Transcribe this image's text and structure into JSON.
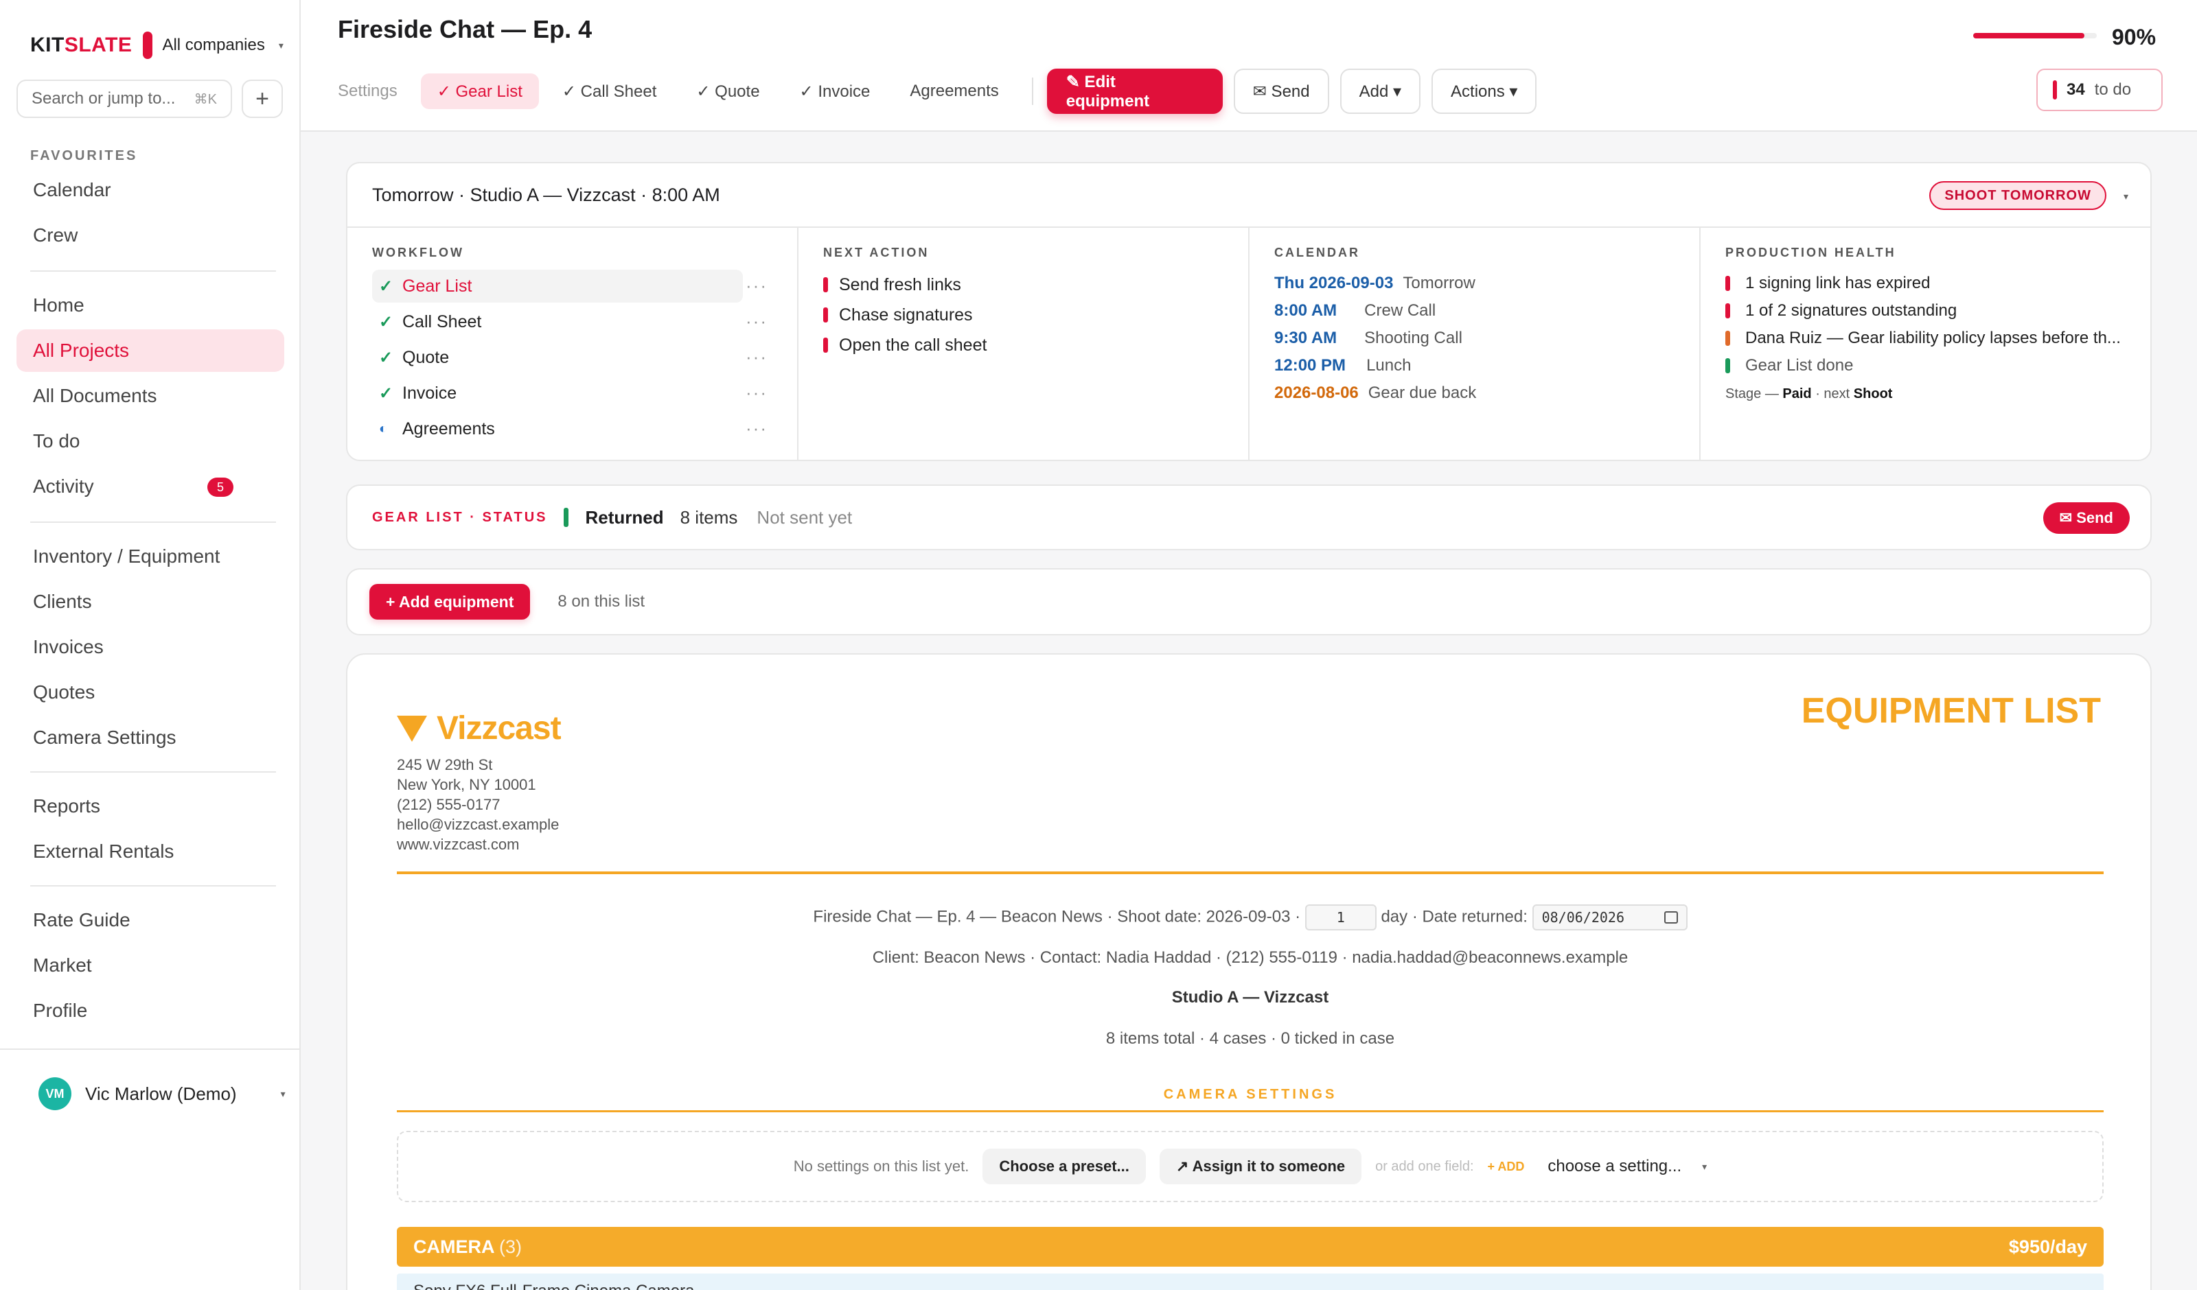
{
  "sidebar": {
    "brand_prefix": "KIT",
    "brand_suffix": "SLATE",
    "company": "All companies",
    "search_placeholder": "Search or jump to...",
    "search_shortcut": "⌘K",
    "add_label": "+",
    "favourites_label": "FAVOURITES",
    "favourites": [
      {
        "label": "Calendar"
      },
      {
        "label": "Crew"
      }
    ],
    "main": [
      {
        "label": "Home"
      },
      {
        "label": "All Projects"
      },
      {
        "label": "All Documents"
      },
      {
        "label": "To do"
      },
      {
        "label": "Activity",
        "badge": "5"
      }
    ],
    "resources": [
      {
        "label": "Inventory / Equipment"
      },
      {
        "label": "Clients"
      },
      {
        "label": "Invoices"
      },
      {
        "label": "Quotes"
      },
      {
        "label": "Camera Settings"
      }
    ],
    "reports": [
      {
        "label": "Reports"
      },
      {
        "label": "External Rentals"
      }
    ],
    "extra": [
      {
        "label": "Rate Guide"
      },
      {
        "label": "Market"
      },
      {
        "label": "Profile"
      }
    ],
    "user": {
      "initials": "VM",
      "name": "Vic Marlow (Demo)"
    }
  },
  "header": {
    "title": "Fireside Chat — Ep. 4",
    "progress_fraction": 0.9,
    "progress_pct": "90%",
    "tabs": [
      {
        "label": "Settings"
      },
      {
        "label": "✓ Gear List"
      },
      {
        "label": "✓ Call Sheet"
      },
      {
        "label": "✓ Quote"
      },
      {
        "label": "✓ Invoice"
      },
      {
        "label": "Agreements"
      }
    ],
    "edit_button": "✎ Edit equipment",
    "send_button": "✉ Send",
    "add_button": "Add ▾",
    "actions_button": "Actions ▾",
    "todo_count": "34",
    "todo_label": "to do"
  },
  "info": {
    "headline": "Tomorrow · Studio A — Vizzcast · 8:00 AM",
    "badge": "SHOOT TOMORROW",
    "workflow_label": "WORKFLOW",
    "workflow": [
      {
        "label": "Gear List",
        "state": "done"
      },
      {
        "label": "Call Sheet",
        "state": "done"
      },
      {
        "label": "Quote",
        "state": "done"
      },
      {
        "label": "Invoice",
        "state": "done"
      },
      {
        "label": "Agreements",
        "state": "partial"
      }
    ],
    "next_action_label": "NEXT ACTION",
    "next_actions": [
      {
        "label": "Send fresh links"
      },
      {
        "label": "Chase signatures"
      },
      {
        "label": "Open the call sheet"
      }
    ],
    "calendar_label": "CALENDAR",
    "calendar": [
      {
        "when": "Thu 2026-09-03",
        "what": "Tomorrow"
      },
      {
        "when": "8:00 AM",
        "what": "Crew Call"
      },
      {
        "when": "9:30 AM",
        "what": "Shooting Call"
      },
      {
        "when": "12:00 PM",
        "what": "Lunch"
      },
      {
        "when": "2026-08-06",
        "what": "Gear due back"
      }
    ],
    "health_label": "PRODUCTION HEALTH",
    "health": [
      {
        "label": "1 signing link has expired",
        "color": "#e0103a"
      },
      {
        "label": "1 of 2 signatures outstanding",
        "color": "#e0103a"
      },
      {
        "label": "Dana Ruiz — Gear liability policy lapses before th...",
        "color": "#e06a2a"
      },
      {
        "label": "Gear List done",
        "color": "#1a9a5a"
      }
    ],
    "stage_prefix": "Stage —",
    "stage_value": "Paid",
    "stage_next_label": "· next",
    "stage_next": "Shoot"
  },
  "status": {
    "label": "GEAR LIST · STATUS",
    "value": "Returned",
    "count": "8 items",
    "note": "Not sent yet",
    "send": "✉ Send"
  },
  "add_bar": {
    "button": "+ Add equipment",
    "note": "8 on this list"
  },
  "document": {
    "company_name": "Vizzcast",
    "heading": "EQUIPMENT LIST",
    "address": [
      "245 W 29th St",
      "New York, NY 10001",
      "(212) 555-0177",
      "hello@vizzcast.example",
      "www.vizzcast.com"
    ],
    "line1_prefix": "Fireside Chat — Ep. 4 — Beacon News · Shoot date: 2026-09-03 ·",
    "days_value": "1",
    "line1_mid": "day · Date returned:",
    "date_returned": "08/06/2026",
    "line2": "Client: Beacon News · Contact: Nadia Haddad · (212) 555-0119 · nadia.haddad@beaconnews.example",
    "location": "Studio A — Vizzcast",
    "summary": "8 items total · 4 cases · 0 ticked in case",
    "settings_title": "CAMERA SETTINGS",
    "no_settings": "No settings on this list yet.",
    "preset_button": "Choose a preset...",
    "assign_button": "↗ Assign it to someone",
    "or_add": "or add one field:",
    "add_link": "+ ADD",
    "choose_setting": "choose a setting...",
    "category": "CAMERA",
    "category_count": "(3)",
    "category_rate": "$950/day",
    "first_item": "Sony FX6 Full-Frame Cinema Camera"
  }
}
